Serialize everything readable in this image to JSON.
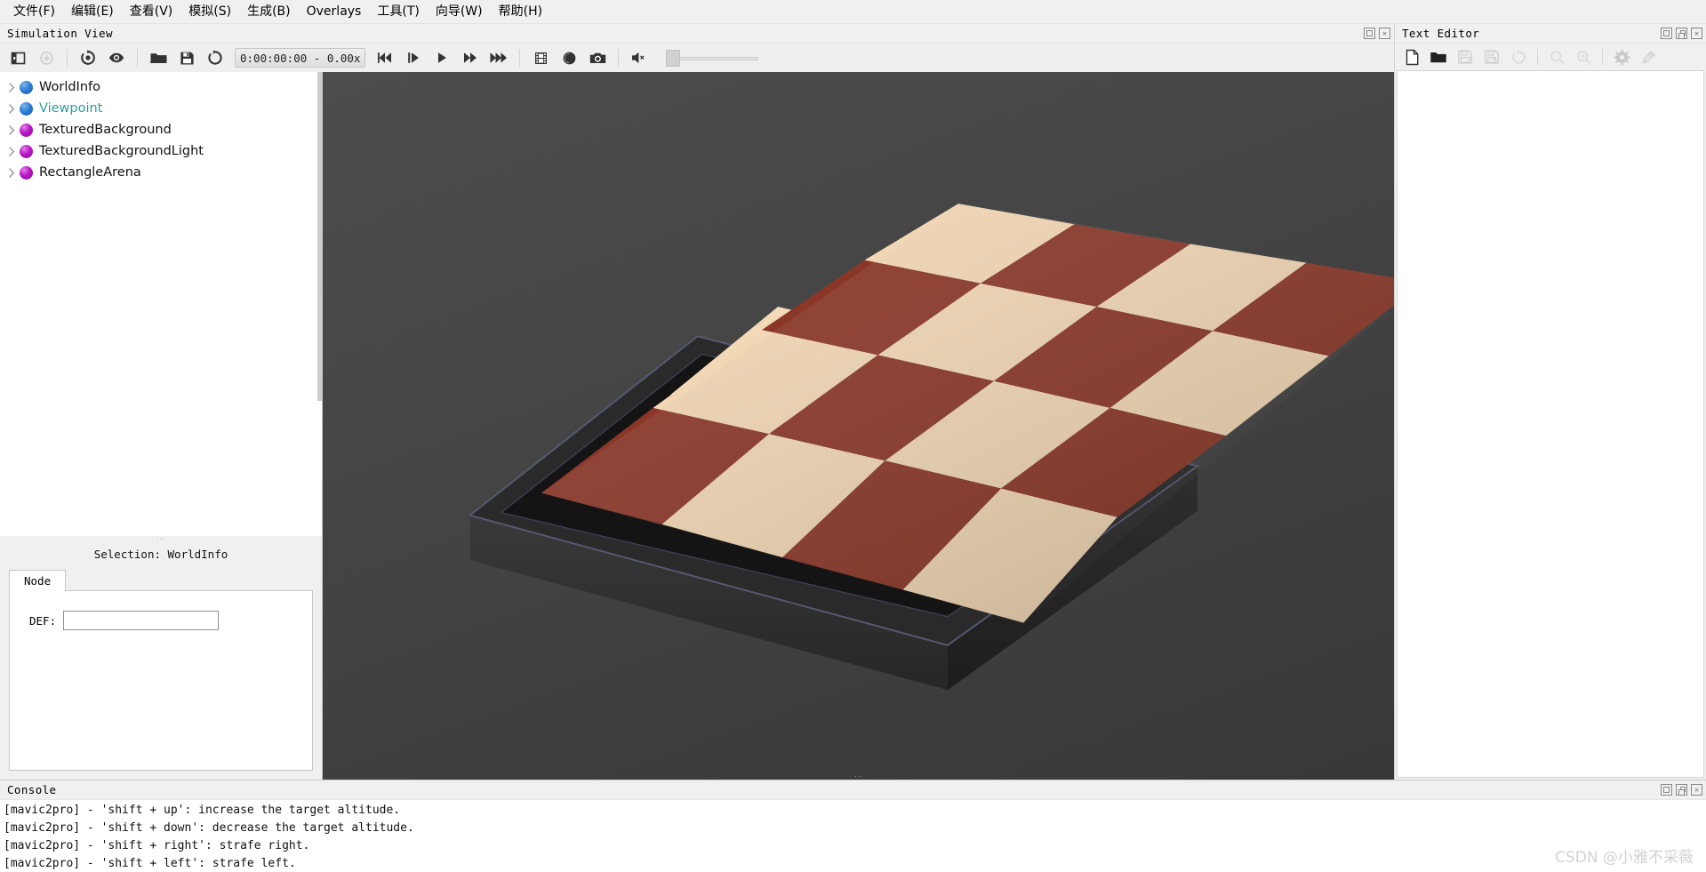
{
  "menu": {
    "items": [
      {
        "label": "文件(F)",
        "accel": "F"
      },
      {
        "label": "编辑(E)",
        "accel": "E"
      },
      {
        "label": "查看(V)",
        "accel": "V"
      },
      {
        "label": "模拟(S)",
        "accel": "S"
      },
      {
        "label": "生成(B)",
        "accel": "B"
      },
      {
        "label": "Overlays",
        "accel": "O"
      },
      {
        "label": "工具(T)",
        "accel": "T"
      },
      {
        "label": "向导(W)",
        "accel": "W"
      },
      {
        "label": "帮助(H)",
        "accel": "H"
      }
    ]
  },
  "simulation_view": {
    "title": "Simulation View",
    "window_buttons": [
      "maximize",
      "close"
    ],
    "toolbar": {
      "time_display": "0:00:00:00 - 0.00x",
      "buttons": [
        {
          "name": "toggle-sidebar-icon",
          "label": "Toggle sidebar",
          "disabled": false
        },
        {
          "name": "add-node-icon",
          "label": "Add node",
          "disabled": true
        },
        {
          "name": "orbit-camera-icon",
          "label": "Orbit camera",
          "disabled": false
        },
        {
          "name": "view-eye-icon",
          "label": "View",
          "disabled": false
        },
        {
          "name": "open-world-icon",
          "label": "Open world",
          "disabled": false
        },
        {
          "name": "save-world-icon",
          "label": "Save world",
          "disabled": false
        },
        {
          "name": "reload-world-icon",
          "label": "Reload world",
          "disabled": false
        },
        {
          "name": "rewind-icon",
          "label": "Reset simulation",
          "disabled": false
        },
        {
          "name": "step-icon",
          "label": "Step",
          "disabled": false
        },
        {
          "name": "play-icon",
          "label": "Play",
          "disabled": false
        },
        {
          "name": "fast-forward-icon",
          "label": "Fast forward",
          "disabled": false
        },
        {
          "name": "run-fastest-icon",
          "label": "Run fastest",
          "disabled": false
        },
        {
          "name": "movie-icon",
          "label": "Make movie",
          "disabled": false
        },
        {
          "name": "record-icon",
          "label": "Record animation",
          "disabled": false
        },
        {
          "name": "screenshot-icon",
          "label": "Take screenshot",
          "disabled": false
        },
        {
          "name": "sound-muted-icon",
          "label": "Sound muted",
          "disabled": false
        }
      ],
      "volume": {
        "value": 0,
        "min": 0,
        "max": 100
      }
    }
  },
  "scene_tree": {
    "nodes": [
      {
        "label": "WorldInfo",
        "dot": "blue",
        "accent": false,
        "expandable": true
      },
      {
        "label": "Viewpoint",
        "dot": "blue",
        "accent": true,
        "expandable": true
      },
      {
        "label": "TexturedBackground",
        "dot": "purple",
        "accent": false,
        "expandable": true
      },
      {
        "label": "TexturedBackgroundLight",
        "dot": "purple",
        "accent": false,
        "expandable": true
      },
      {
        "label": "RectangleArena",
        "dot": "purple",
        "accent": false,
        "expandable": true
      }
    ]
  },
  "selection": {
    "title": "Selection: WorldInfo",
    "tabs": [
      {
        "label": "Node",
        "active": true
      }
    ],
    "fields": [
      {
        "label": "DEF:",
        "value": "",
        "placeholder": ""
      }
    ]
  },
  "text_editor": {
    "title": "Text Editor",
    "window_buttons": [
      "maximize",
      "restore",
      "close"
    ],
    "toolbar": [
      {
        "name": "new-file-icon",
        "label": "New",
        "disabled": false
      },
      {
        "name": "open-file-icon",
        "label": "Open",
        "disabled": false
      },
      {
        "name": "save-file-icon",
        "label": "Save",
        "disabled": true
      },
      {
        "name": "save-as-file-icon",
        "label": "Save As",
        "disabled": true
      },
      {
        "name": "revert-file-icon",
        "label": "Revert",
        "disabled": true
      },
      {
        "name": "find-icon",
        "label": "Find",
        "disabled": true
      },
      {
        "name": "find-replace-icon",
        "label": "Find and Replace",
        "disabled": true
      },
      {
        "name": "gear-icon",
        "label": "Build",
        "disabled": false
      },
      {
        "name": "clean-icon",
        "label": "Clean",
        "disabled": false
      }
    ],
    "content": ""
  },
  "console": {
    "title": "Console",
    "window_buttons": [
      "maximize",
      "restore",
      "close"
    ],
    "lines": [
      "[mavic2pro] - 'shift + up': increase the target altitude.",
      "[mavic2pro] - 'shift + down': decrease the target altitude.",
      "[mavic2pro] - 'shift + right': strafe right.",
      "[mavic2pro] - 'shift + left': strafe left."
    ]
  },
  "watermark": {
    "text": "CSDN @小雅不采薇"
  },
  "colors": {
    "accent_teal": "#2aa198",
    "node_blue": "#2f7fd6",
    "node_purple": "#b915c7",
    "viewport_bg": "#464646",
    "panel_bg": "#f0f0f0"
  }
}
